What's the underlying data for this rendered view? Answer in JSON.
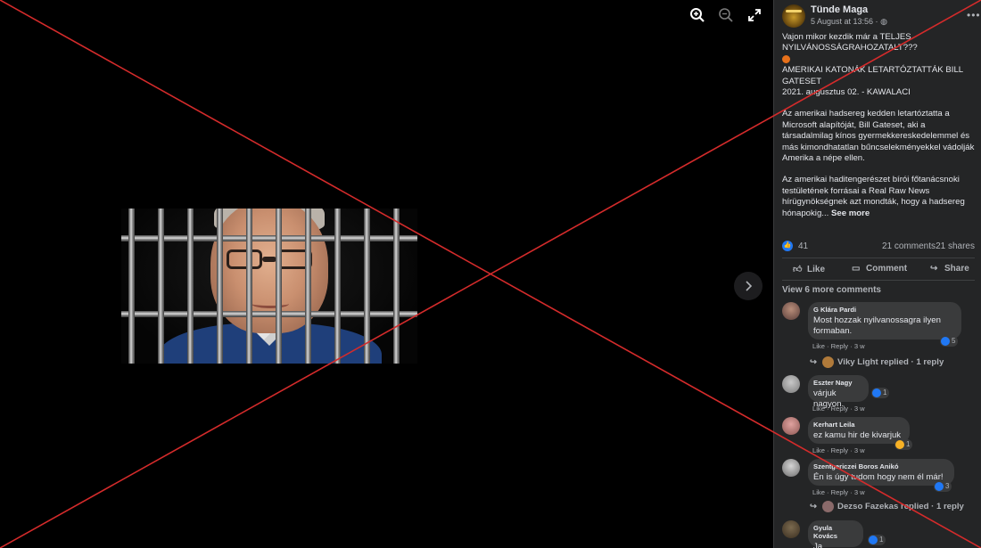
{
  "viewer": {
    "icons": {
      "zoom_in": "zoom-in-icon",
      "zoom_out": "zoom-out-icon",
      "fullscreen": "fullscreen-icon",
      "next": "chevron-right-icon"
    }
  },
  "post": {
    "author": "Tünde Maga",
    "time": "5 August at 13:56 · ",
    "text": {
      "p1": "Vajon mikor kezdik már a TELJES NYILVÁNOSSÁGRAHOZATALT???",
      "p2": "AMERIKAI KATONÁK LETARTÓZTATTÁK BILL GATESET",
      "p3": "2021. augusztus 02. - KAWALACI",
      "p4": "Az amerikai hadsereg kedden letartóztatta a Microsoft alapítóját, Bill Gateset, aki a társadalmilag kínos gyermekkereskedelemmel és más kimondhatatlan bűncselekményekkel vádolják Amerika a népe ellen.",
      "p5": "Az amerikai haditengerészet bírói főtanácsnoki testületének forrásai a Real Raw News hírügynökségnek azt mondták, hogy a hadsereg hónapokig...",
      "see_more": "See more"
    },
    "stats": {
      "likes": "41",
      "comments": "21 comments",
      "shares": "21 shares"
    },
    "actions": {
      "like": "Like",
      "comment": "Comment",
      "share": "Share"
    },
    "view_more": "View 6 more comments",
    "colors": {
      "panel": "#242526",
      "bubble": "#3a3b3c",
      "accent": "#2078f4",
      "overlay": "#d42b2b"
    }
  },
  "comments": [
    {
      "name": "G Klára Pardi",
      "text": "Most hozzak nyilvanossagra ilyen formaban.",
      "reaction": "5",
      "meta": "Like · Reply · 3 w",
      "reply": "Viky Light replied · 1 reply"
    },
    {
      "name": "Eszter Nagy",
      "text": "várjuk nagyon.",
      "reaction": "1",
      "meta": "Like · Reply · 3 w"
    },
    {
      "name": "Kerhart Leila",
      "text": "ez kamu hir de kivarjuk",
      "reaction": "1",
      "meta": "Like · Reply · 3 w"
    },
    {
      "name": "Szentgericzei Boros Anikó",
      "text": "Én is úgy tudom hogy nem él már!",
      "reaction": "3",
      "meta": "Like · Reply · 3 w",
      "reply": "Dezso Fazekas replied · 1 reply"
    },
    {
      "name": "Gyula Kovács",
      "text": "Ja",
      "reaction": "1"
    }
  ]
}
